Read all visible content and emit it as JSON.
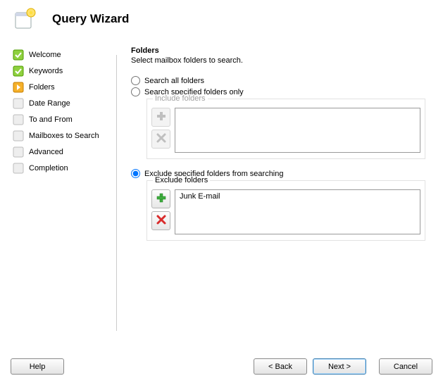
{
  "header": {
    "title": "Query Wizard"
  },
  "nav": {
    "items": [
      {
        "label": "Welcome",
        "state": "done"
      },
      {
        "label": "Keywords",
        "state": "done"
      },
      {
        "label": "Folders",
        "state": "current"
      },
      {
        "label": "Date Range",
        "state": "pending"
      },
      {
        "label": "To and From",
        "state": "pending"
      },
      {
        "label": "Mailboxes to Search",
        "state": "pending"
      },
      {
        "label": "Advanced",
        "state": "pending"
      },
      {
        "label": "Completion",
        "state": "pending"
      }
    ]
  },
  "content": {
    "title": "Folders",
    "subtitle": "Select mailbox folders to search.",
    "options": {
      "search_all": "Search all folders",
      "search_specified": "Search specified folders only",
      "exclude_specified": "Exclude specified folders from searching"
    },
    "include_group": {
      "legend": "Include folders",
      "items": []
    },
    "exclude_group": {
      "legend": "Exclude folders",
      "items": [
        "Junk E-mail"
      ]
    },
    "selected_option": "exclude_specified"
  },
  "footer": {
    "help": "Help",
    "back": "< Back",
    "next": "Next >",
    "cancel": "Cancel"
  },
  "icons": {
    "add": "add-icon",
    "remove": "remove-icon"
  }
}
